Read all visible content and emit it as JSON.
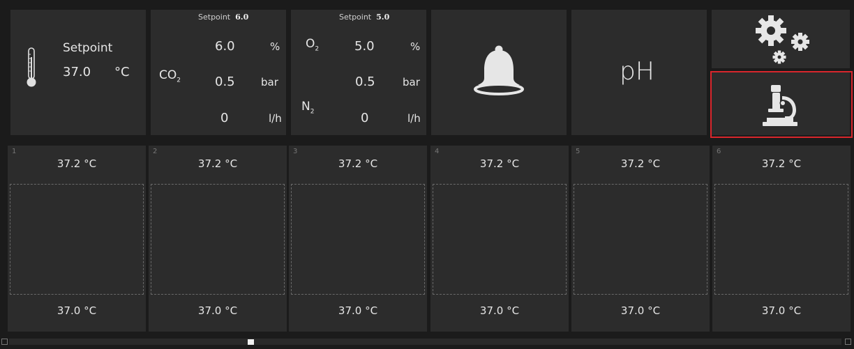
{
  "temperature": {
    "setpoint_label": "Setpoint",
    "setpoint_value": "37.0",
    "unit": "°C"
  },
  "co2": {
    "header_label": "Setpoint",
    "header_value": "6.0",
    "gas": "CO",
    "gas_sub": "2",
    "percent_value": "6.0",
    "percent_unit": "%",
    "pressure_value": "0.5",
    "pressure_unit": "bar",
    "flow_value": "0",
    "flow_unit": "l/h"
  },
  "o2n2": {
    "header_label": "Setpoint",
    "header_value": "5.0",
    "gas1": "O",
    "gas1_sub": "2",
    "gas2": "N",
    "gas2_sub": "2",
    "percent_value": "5.0",
    "percent_unit": "%",
    "pressure_value": "0.5",
    "pressure_unit": "bar",
    "flow_value": "0",
    "flow_unit": "l/h"
  },
  "ph": {
    "label": "pH"
  },
  "wells": [
    {
      "number": "1",
      "top_temp": "37.2 °C",
      "bottom_temp": "37.0 °C"
    },
    {
      "number": "2",
      "top_temp": "37.2 °C",
      "bottom_temp": "37.0 °C"
    },
    {
      "number": "3",
      "top_temp": "37.2 °C",
      "bottom_temp": "37.0 °C"
    },
    {
      "number": "4",
      "top_temp": "37.2 °C",
      "bottom_temp": "37.0 °C"
    },
    {
      "number": "5",
      "top_temp": "37.2 °C",
      "bottom_temp": "37.0 °C"
    },
    {
      "number": "6",
      "top_temp": "37.2 °C",
      "bottom_temp": "37.0 °C"
    }
  ],
  "icons": {
    "thermometer": "thermometer-icon",
    "bell": "bell-icon",
    "settings": "gears-icon",
    "microscope": "microscope-icon"
  },
  "colors": {
    "background": "#1b1b1b",
    "panel": "#2c2c2c",
    "text": "#e6e6e6",
    "selection": "#d9262c"
  },
  "scrollbar": {
    "position": 0.29
  }
}
